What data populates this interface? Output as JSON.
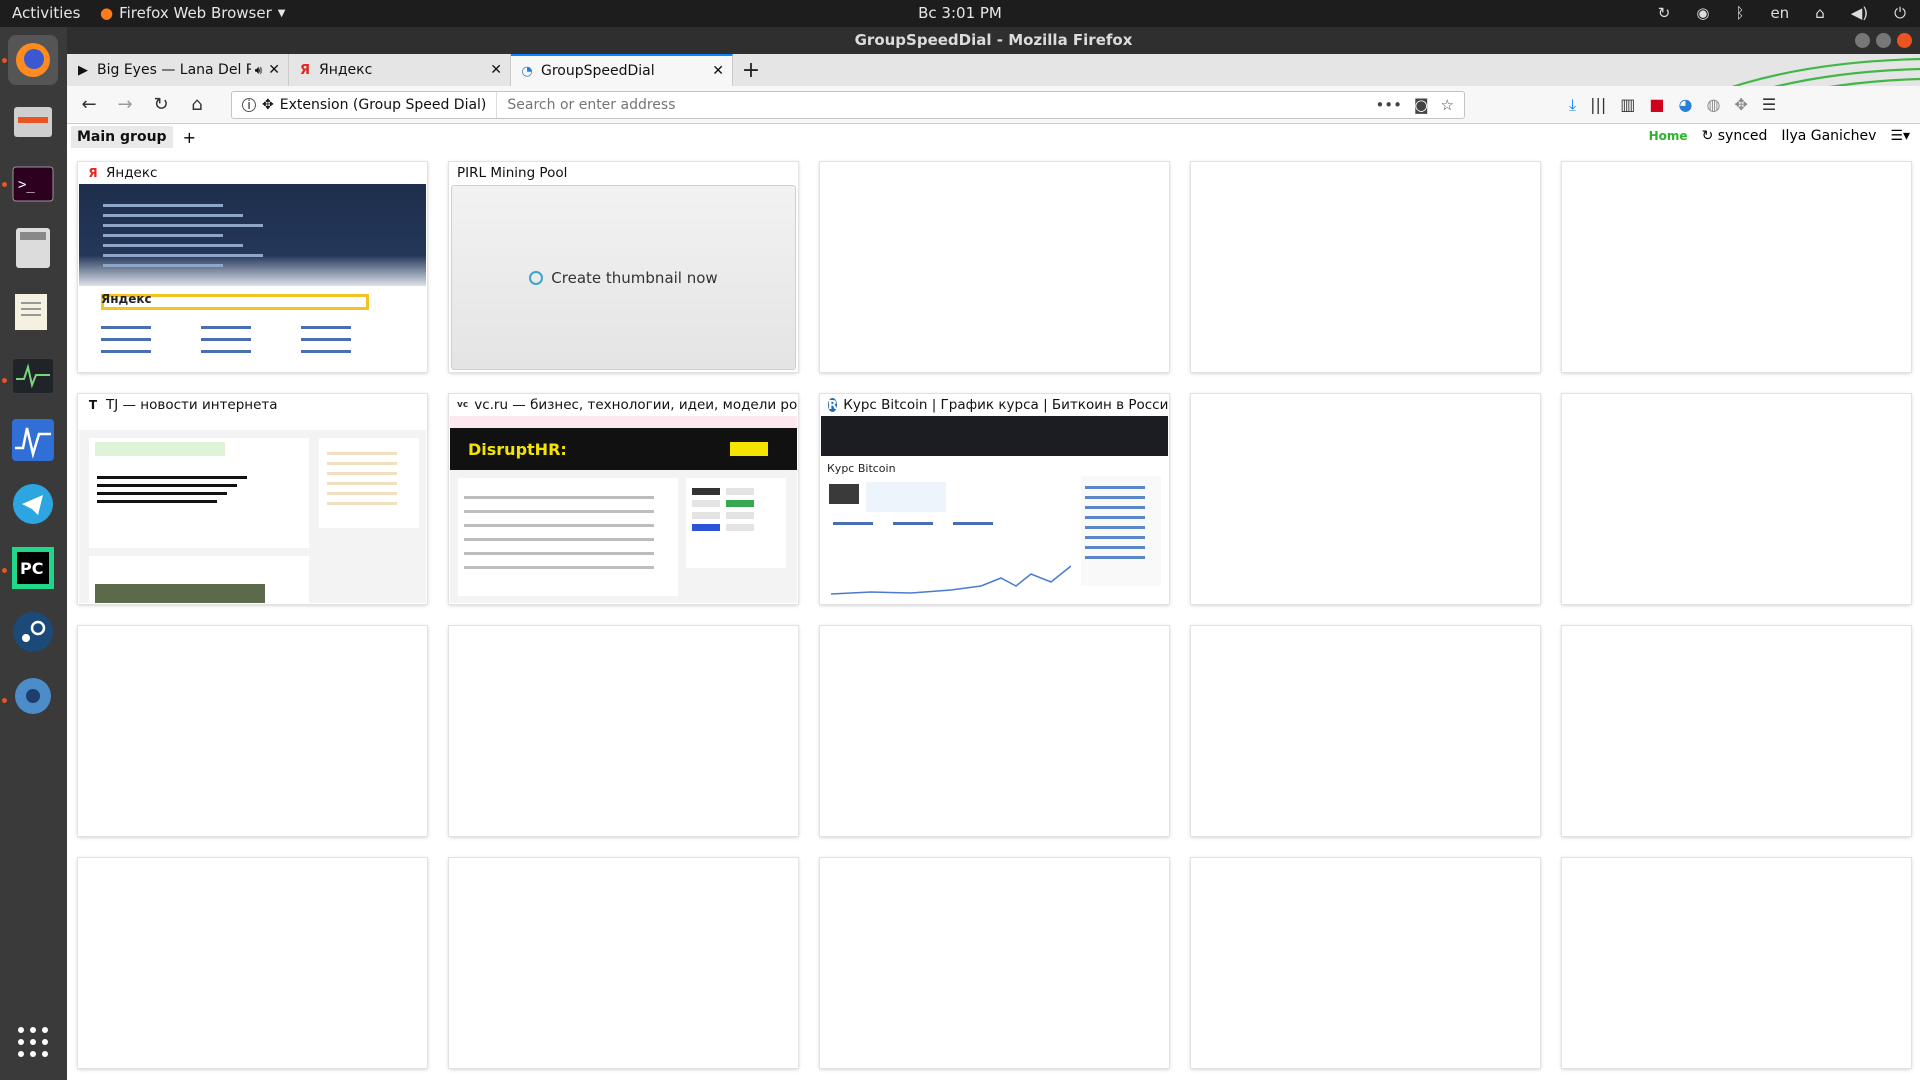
{
  "topbar": {
    "activities": "Activities",
    "app_name": "Firefox Web Browser",
    "clock": "Вс  3:01 PM",
    "lang": "en"
  },
  "window": {
    "title": "GroupSpeedDial - Mozilla Firefox"
  },
  "tabs": [
    {
      "title": "Big Eyes — Lana Del Rey",
      "icon": "play-icon"
    },
    {
      "title": "Яндекс",
      "icon": "yandex-icon"
    },
    {
      "title": "GroupSpeedDial",
      "icon": "gsd-icon"
    }
  ],
  "navbar": {
    "identity_label": "Extension (Group Speed Dial)",
    "url_placeholder": "Search or enter address"
  },
  "gsd": {
    "group_name": "Main group",
    "add_label": "+",
    "home_label": "Home",
    "synced_label": "synced",
    "user_name": "Ilya Ganichev"
  },
  "dials": [
    {
      "title": "Яндекс",
      "kind": "yandex"
    },
    {
      "title": "PIRL Mining Pool",
      "kind": "create"
    },
    {
      "title": "",
      "kind": "empty"
    },
    {
      "title": "",
      "kind": "empty"
    },
    {
      "title": "",
      "kind": "empty"
    },
    {
      "title": "TJ — новости интернета",
      "kind": "tj"
    },
    {
      "title": "vc.ru — бизнес, технологии, идеи, модели роста",
      "kind": "vc"
    },
    {
      "title": "Курс Bitcoin | График курса | Биткоин в России",
      "kind": "btc"
    },
    {
      "title": "",
      "kind": "empty"
    },
    {
      "title": "",
      "kind": "empty"
    },
    {
      "title": "",
      "kind": "empty"
    },
    {
      "title": "",
      "kind": "empty"
    },
    {
      "title": "",
      "kind": "empty"
    },
    {
      "title": "",
      "kind": "empty"
    },
    {
      "title": "",
      "kind": "empty"
    },
    {
      "title": "",
      "kind": "empty"
    },
    {
      "title": "",
      "kind": "empty"
    },
    {
      "title": "",
      "kind": "empty"
    },
    {
      "title": "",
      "kind": "empty"
    },
    {
      "title": "",
      "kind": "empty"
    }
  ],
  "create_thumbnail_label": "Create thumbnail now",
  "thumb_text": {
    "yandex_logo": "Яндекс",
    "vc_banner": "DisruptHR:",
    "btc_heading": "Курс Bitcoin"
  }
}
